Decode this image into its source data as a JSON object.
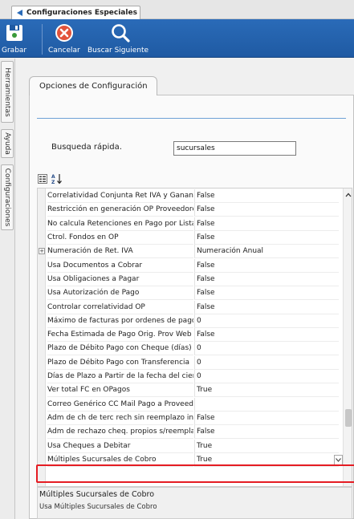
{
  "window": {
    "tab_title": "Configuraciones Especiales"
  },
  "toolbar": {
    "save_label": "Grabar",
    "cancel_label": "Cancelar",
    "find_next_label": "Buscar Siguiente"
  },
  "side_tabs": [
    "Herramientas",
    "Ayuda",
    "Configuraciones"
  ],
  "section": {
    "tab_label": "Opciones de Configuración",
    "search_label": "Busqueda rápida.",
    "search_value": "sucursales"
  },
  "properties": [
    {
      "name": "Correlatividad Conjunta Ret IVA y Ganancias",
      "value": "False",
      "expandable": false
    },
    {
      "name": "Restricción en generación OP Proveedores",
      "value": "False",
      "expandable": false
    },
    {
      "name": "No calcula Retenciones en Pago por Lista",
      "value": "False",
      "expandable": false
    },
    {
      "name": "Ctrol. Fondos en OP",
      "value": "False",
      "expandable": false
    },
    {
      "name": "Numeración de Ret. IVA",
      "value": "Numeración Anual",
      "expandable": true
    },
    {
      "name": "Usa Documentos a Cobrar",
      "value": "False",
      "expandable": false
    },
    {
      "name": "Usa Obligaciones a Pagar",
      "value": "False",
      "expandable": false
    },
    {
      "name": "Usa Autorización de Pago",
      "value": "False",
      "expandable": false
    },
    {
      "name": "Controlar correlatividad OP",
      "value": "False",
      "expandable": false
    },
    {
      "name": "Máximo de facturas por ordenes de pago",
      "value": "0",
      "expandable": false
    },
    {
      "name": "Fecha Estimada de Pago Orig. Prov Web",
      "value": "False",
      "expandable": false
    },
    {
      "name": "Plazo de Débito Pago con Cheque (días)",
      "value": "0",
      "expandable": false
    },
    {
      "name": "Plazo de Débito Pago con Transferencia",
      "value": "0",
      "expandable": false
    },
    {
      "name": "Días de Plazo a Partir de la fecha del cierre",
      "value": "0",
      "expandable": false
    },
    {
      "name": "Ver total FC en OPagos",
      "value": "True",
      "expandable": false
    },
    {
      "name": "Correo Genérico CC Mail Pago a Proveedores",
      "value": "",
      "expandable": false
    },
    {
      "name": "Adm de ch de terc rech sin reemplazo in",
      "value": "False",
      "expandable": false
    },
    {
      "name": "Adm de rechazo cheq. propios s/reemplazo",
      "value": "False",
      "expandable": false
    },
    {
      "name": "Usa Cheques a Debitar",
      "value": "True",
      "expandable": false
    },
    {
      "name": "Múltiples Sucursales de Cobro",
      "value": "True",
      "expandable": false,
      "selected": true
    }
  ],
  "description": {
    "title": "Múltiples Sucursales de Cobro",
    "text": "Usa Múltiples Sucursales de Cobro"
  },
  "colors": {
    "toolbar_blue": "#1f5aa3",
    "highlight_red": "#e51c23"
  }
}
